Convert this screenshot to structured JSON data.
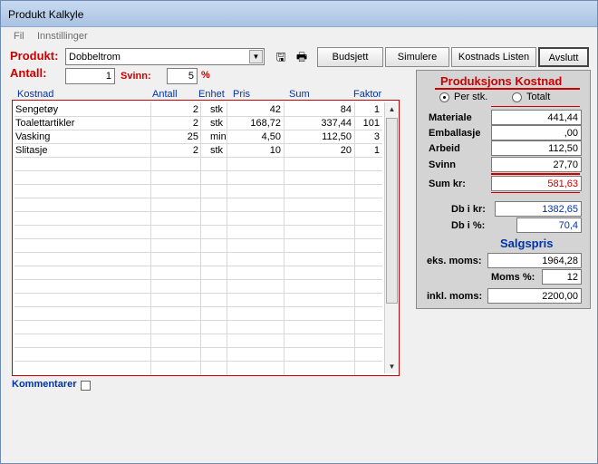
{
  "window": {
    "title": "Produkt Kalkyle"
  },
  "menu": [
    {
      "label": "Fil"
    },
    {
      "label": "Innstillinger"
    }
  ],
  "product": {
    "label": "Produkt:",
    "value": "Dobbeltrom"
  },
  "antall": {
    "label": "Antall:",
    "value": "1"
  },
  "svinn": {
    "label": "Svinn:",
    "value": "5",
    "unit": "%"
  },
  "toolbar": {
    "icons": [
      "save-icon",
      "print-icon"
    ],
    "buttons": [
      {
        "label": "Budsjett"
      },
      {
        "label": "Simulere"
      },
      {
        "label": "Kostnads Listen"
      },
      {
        "label": "Avslutt"
      }
    ]
  },
  "table": {
    "columns": [
      "Kostnad",
      "Antall",
      "Enhet",
      "Pris",
      "Sum",
      "Faktor"
    ],
    "rows": [
      {
        "kostnad": "Sengetøy",
        "antall": "2",
        "enhet": "stk",
        "pris": "42",
        "sum": "84",
        "faktor": "1"
      },
      {
        "kostnad": "Toalettartikler",
        "antall": "2",
        "enhet": "stk",
        "pris": "168,72",
        "sum": "337,44",
        "faktor": "101"
      },
      {
        "kostnad": "Vasking",
        "antall": "25",
        "enhet": "min",
        "pris": "4,50",
        "sum": "112,50",
        "faktor": "3"
      },
      {
        "kostnad": "Slitasje",
        "antall": "2",
        "enhet": "stk",
        "pris": "10",
        "sum": "20",
        "faktor": "1"
      }
    ]
  },
  "comments": {
    "label": "Kommentarer"
  },
  "panel": {
    "title": "Produksjons Kostnad",
    "radio_per": "Per stk.",
    "radio_total": "Totalt",
    "materiale": {
      "label": "Materiale",
      "value": "441,44"
    },
    "emballasje": {
      "label": "Emballasje",
      "value": ",00"
    },
    "arbeid": {
      "label": "Arbeid",
      "value": "112,50"
    },
    "svinn": {
      "label": "Svinn",
      "value": "27,70"
    },
    "sum": {
      "label": "Sum kr:",
      "value": "581,63"
    },
    "db_kr": {
      "label": "Db i kr:",
      "value": "1382,65"
    },
    "db_pct": {
      "label": "Db i %:",
      "value": "70,4"
    },
    "salgspris_title": "Salgspris",
    "eks_moms": {
      "label": "eks. moms:",
      "value": "1964,28"
    },
    "moms_pct": {
      "label": "Moms %:",
      "value": "12"
    },
    "inkl_moms": {
      "label": "inkl. moms:",
      "value": "2200,00"
    }
  },
  "colors": {
    "accent_red": "#cc0000",
    "accent_blue": "#0033aa"
  }
}
